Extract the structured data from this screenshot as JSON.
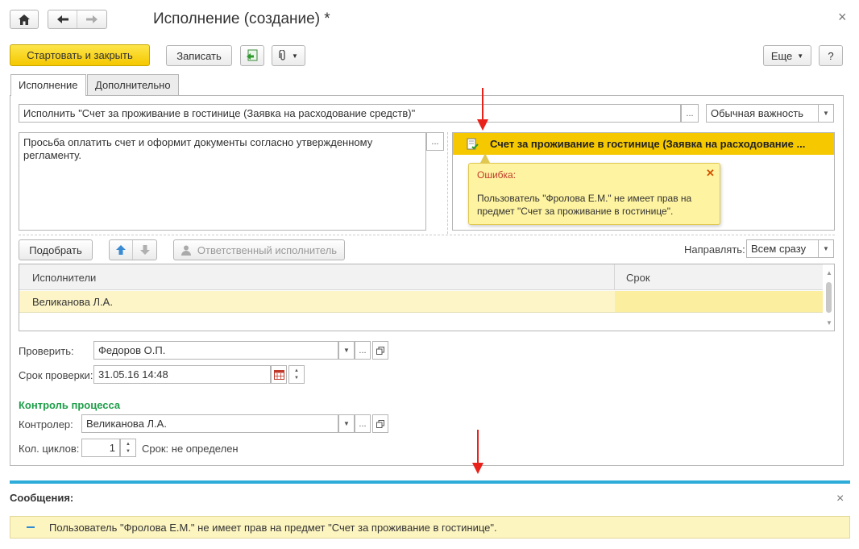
{
  "window": {
    "title": "Исполнение (создание) *",
    "close_glyph": "×"
  },
  "nav": {
    "home_icon": "home-icon",
    "back_icon": "arrow-left-icon",
    "forward_icon": "arrow-right-icon"
  },
  "toolbar": {
    "start_close_label": "Стартовать и закрыть",
    "save_label": "Записать",
    "more_label": "Еще",
    "help_label": "?"
  },
  "tabs": [
    {
      "label": "Исполнение"
    },
    {
      "label": "Дополнительно"
    }
  ],
  "form": {
    "subject_value": "Исполнить \"Счет за проживание в гостинице (Заявка на расходование средств)\"",
    "importance_value": "Обычная важность",
    "description_value": "Просьба оплатить счет и оформит документы согласно утвержденному регламенту.",
    "attached_subject": "Счет за проживание в гостинице (Заявка на расходование ...",
    "ellipsis": "..."
  },
  "error_tooltip": {
    "title": "Ошибка:",
    "message": "Пользователь \"Фролова Е.М.\" не имеет прав на предмет \"Счет за проживание в гостинице\"."
  },
  "performers_toolbar": {
    "pick_label": "Подобрать",
    "responsible_label": "Ответственный исполнитель",
    "direct_label": "Направлять:",
    "direct_value": "Всем сразу"
  },
  "table": {
    "columns": [
      "Исполнители",
      "Срок"
    ],
    "rows": [
      {
        "performer": "Великанова Л.А.",
        "deadline": ""
      }
    ]
  },
  "check": {
    "checker_label": "Проверить:",
    "checker_value": "Федоров О.П.",
    "deadline_label": "Срок проверки:",
    "deadline_value": "31.05.16 14:48"
  },
  "process_control": {
    "heading": "Контроль процесса",
    "controller_label": "Контролер:",
    "controller_value": "Великанова Л.А.",
    "cycles_label": "Кол. циклов:",
    "cycles_value": "1",
    "term_text": "Срок: не определен"
  },
  "messages": {
    "heading": "Сообщения:",
    "close_glyph": "×",
    "items": [
      {
        "text": "Пользователь \"Фролова Е.М.\" не имеет прав на предмет \"Счет за проживание в гостинице\"."
      }
    ]
  },
  "colors": {
    "accent_yellow": "#f5c800",
    "highlight_row": "#fdf5c8",
    "error_title": "#c0392b",
    "process_heading": "#1e9e49",
    "messages_bar": "#2eacd9",
    "annotation_arrow": "#e8211a"
  }
}
